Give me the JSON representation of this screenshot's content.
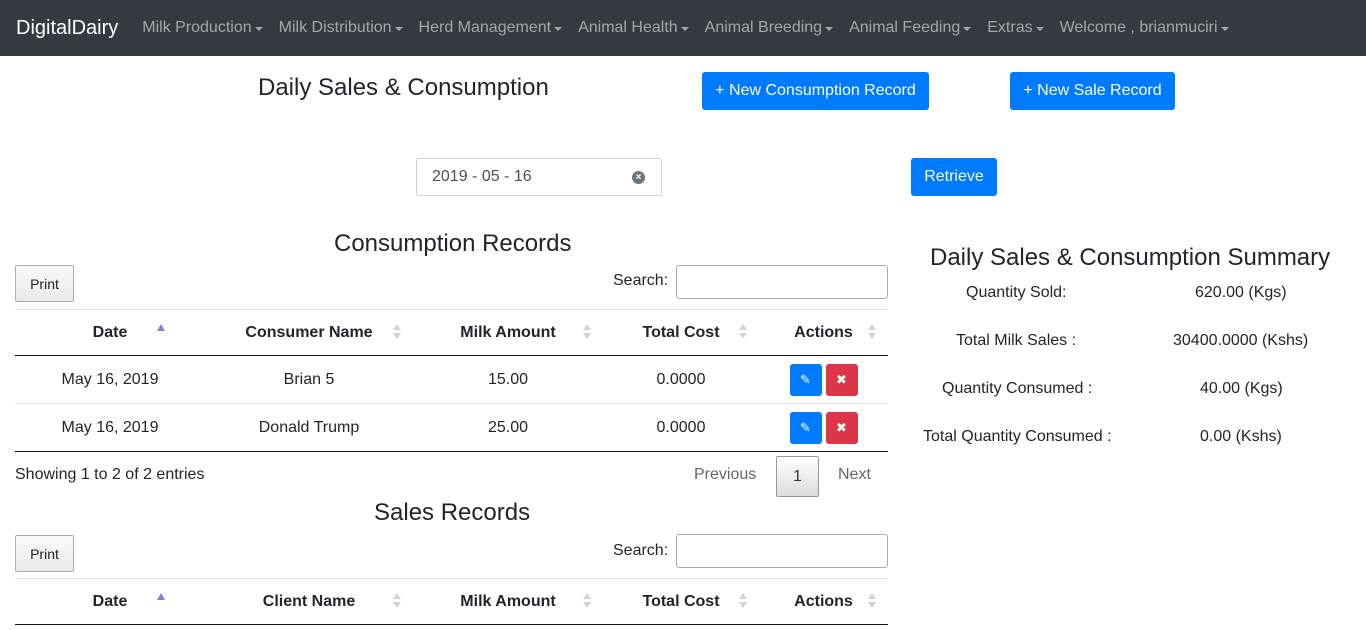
{
  "navbar": {
    "brand": "DigitalDairy",
    "items": [
      {
        "label": "Milk Production"
      },
      {
        "label": "Milk Distribution"
      },
      {
        "label": "Herd Management"
      },
      {
        "label": "Animal Health"
      },
      {
        "label": "Animal Breeding"
      },
      {
        "label": "Animal Feeding"
      },
      {
        "label": "Extras"
      },
      {
        "label": "Welcome , brianmuciri"
      }
    ]
  },
  "header": {
    "title": "Daily Sales & Consumption",
    "new_consumption_label": "+ New Consumption Record",
    "new_sale_label": "+ New Sale Record"
  },
  "filter": {
    "date_value": "2019 - 05 - 16",
    "retrieve_label": "Retrieve"
  },
  "consumption": {
    "title": "Consumption Records",
    "print_label": "Print",
    "search_label": "Search:",
    "columns": [
      "Date",
      "Consumer Name",
      "Milk Amount",
      "Total Cost",
      "Actions"
    ],
    "rows": [
      {
        "date": "May 16, 2019",
        "name": "Brian 5",
        "amount": "15.00",
        "cost": "0.0000"
      },
      {
        "date": "May 16, 2019",
        "name": "Donald Trump",
        "amount": "25.00",
        "cost": "0.0000"
      }
    ],
    "info": "Showing 1 to 2 of 2 entries",
    "pager": {
      "previous": "Previous",
      "current": "1",
      "next": "Next"
    }
  },
  "sales": {
    "title": "Sales Records",
    "print_label": "Print",
    "search_label": "Search:",
    "columns": [
      "Date",
      "Client Name",
      "Milk Amount",
      "Total Cost",
      "Actions"
    ]
  },
  "summary": {
    "title": "Daily Sales & Consumption Summary",
    "rows": [
      {
        "label": "Quantity Sold:",
        "value": "620.00 (Kgs)"
      },
      {
        "label": "Total Milk Sales :",
        "value": "30400.0000 (Kshs)"
      },
      {
        "label": "Quantity Consumed :",
        "value": "40.00 (Kgs)"
      },
      {
        "label": "Total Quantity Consumed :",
        "value": "0.00 (Kshs)"
      }
    ]
  },
  "icons": {
    "edit": "pencil-square-icon",
    "delete": "x-icon",
    "clear": "clear-circle-icon"
  },
  "colors": {
    "navbar": "#343a40",
    "primary": "#007bff",
    "danger": "#dc3545"
  }
}
